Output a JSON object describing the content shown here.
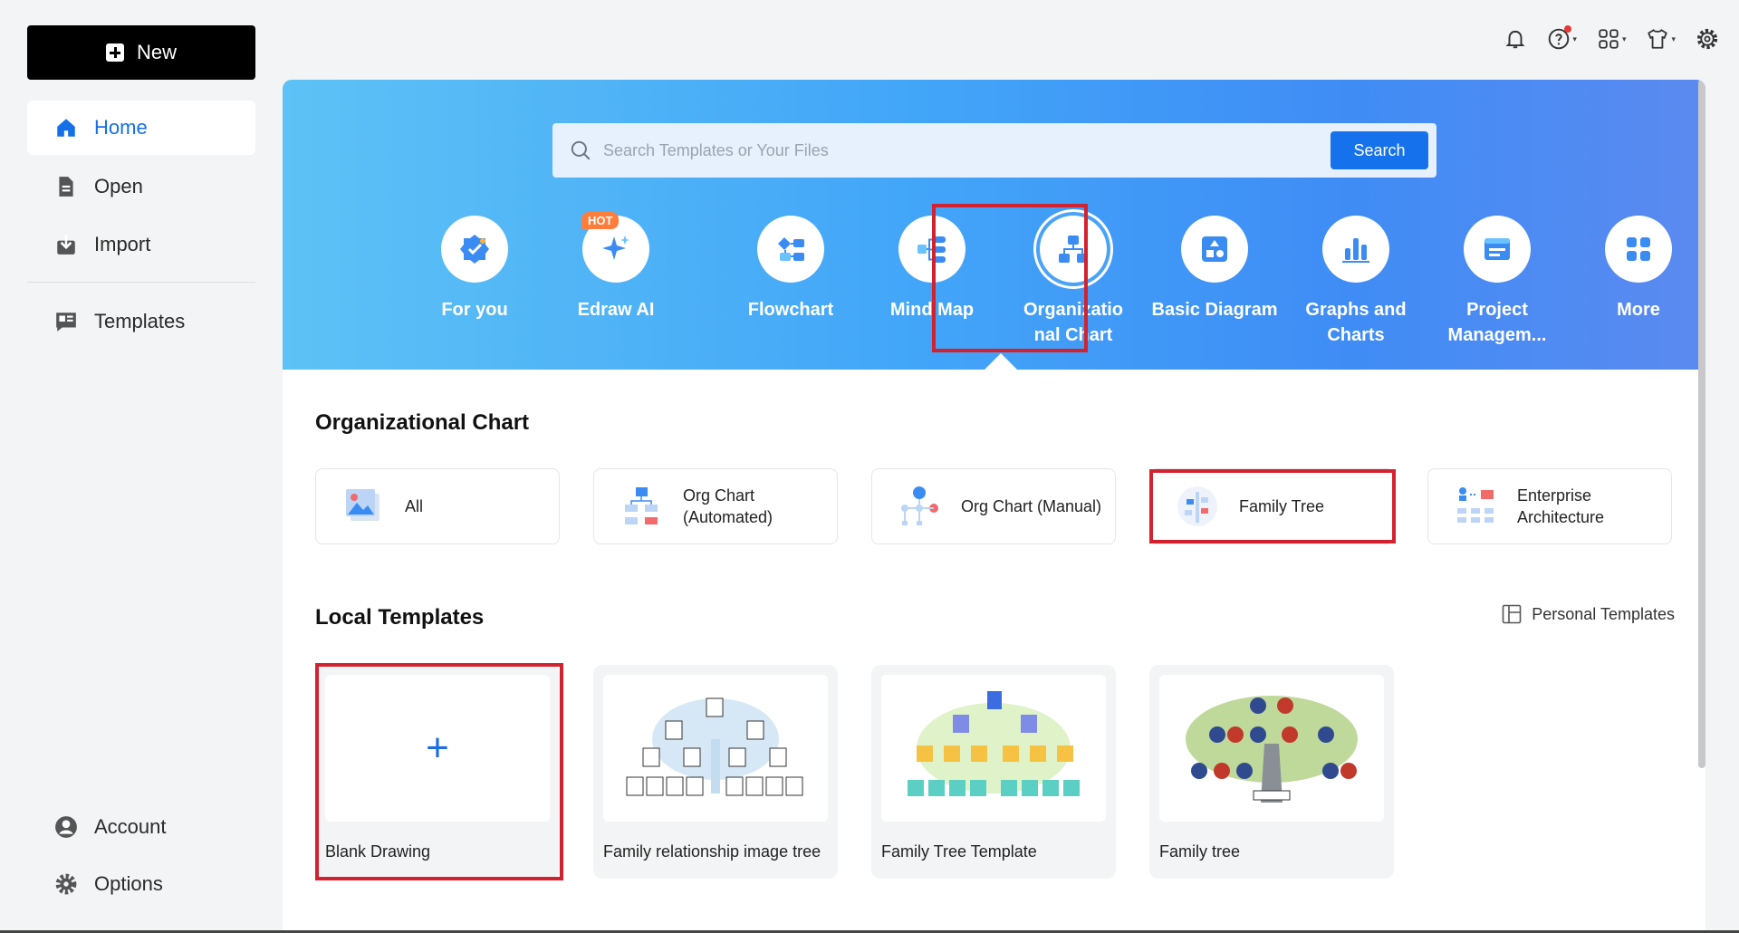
{
  "sidebar": {
    "new_label": "New",
    "items": [
      {
        "label": "Home"
      },
      {
        "label": "Open"
      },
      {
        "label": "Import"
      },
      {
        "label": "Templates"
      },
      {
        "label": "Account"
      },
      {
        "label": "Options"
      }
    ]
  },
  "search": {
    "placeholder": "Search Templates or Your Files",
    "button_label": "Search"
  },
  "categories": [
    {
      "label": "For you",
      "icon": "for-you-icon"
    },
    {
      "label": "Edraw AI",
      "icon": "edraw-ai-icon",
      "badge": "HOT"
    },
    {
      "label": "Flowchart",
      "icon": "flowchart-icon"
    },
    {
      "label": "Mind Map",
      "icon": "mind-map-icon"
    },
    {
      "label": "Organizatio nal Chart",
      "icon": "org-chart-icon",
      "selected": true
    },
    {
      "label": "Basic Diagram",
      "icon": "basic-diagram-icon"
    },
    {
      "label": "Graphs and Charts",
      "icon": "graphs-icon"
    },
    {
      "label": "Project Managem...",
      "icon": "project-icon"
    },
    {
      "label": "More",
      "icon": "more-icon"
    }
  ],
  "section": {
    "title": "Organizational Chart",
    "subcategories": [
      {
        "label": "All"
      },
      {
        "label": "Org Chart (Automated)"
      },
      {
        "label": "Org Chart (Manual)"
      },
      {
        "label": "Family Tree"
      },
      {
        "label": "Enterprise Architecture"
      }
    ]
  },
  "local": {
    "title": "Local Templates",
    "personal_label": "Personal Templates",
    "templates": [
      {
        "label": "Blank Drawing"
      },
      {
        "label": "Family relationship image tree"
      },
      {
        "label": "Family Tree Template"
      },
      {
        "label": "Family tree"
      }
    ]
  },
  "colors": {
    "accent": "#1672ec",
    "highlight": "#d3222f"
  }
}
